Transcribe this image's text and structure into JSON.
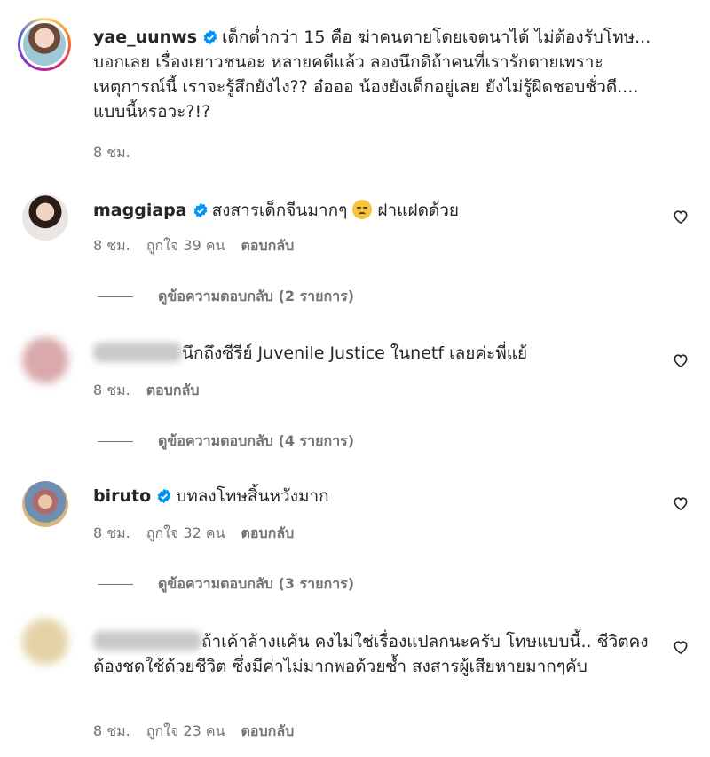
{
  "comments": [
    {
      "username": "yae_uunws",
      "text": "เด็กต่ำกว่า 15 คือ ฆ่าคนตายโดยเจตนาได้ ไม่ต้องรับโทษ... บอกเลย เรื่องเยาวชนอะ หลายคดีแล้ว ลองนึกดิถ้าคนที่เรารักตายเพราะเหตุการณ์นี้ เราจะรู้สึกยังไง?? อ๋อออ น้องยังเด็กอยู่เลย ยังไม่รู้ผิดชอบชั่วดี.... แบบนี้หรอวะ?!?",
      "time": "8 ชม.",
      "verified": true
    },
    {
      "username": "maggiapa",
      "text_before": "สงสารเด็กจีนมากๆ",
      "text_after": "ฝาแฝดด้วย",
      "emoji": "pensive-face",
      "time": "8 ชม.",
      "likes": "ถูกใจ 39 คน",
      "reply": "ตอบกลับ",
      "view_replies": "ดูข้อความตอบกลับ (2 รายการ)",
      "verified": true
    },
    {
      "username": "",
      "text": "นึกถึงซีรีย์ Juvenile Justice ในnetf เลยค่ะพี่แย้",
      "time": "8 ชม.",
      "reply": "ตอบกลับ",
      "view_replies": "ดูข้อความตอบกลับ (4 รายการ)"
    },
    {
      "username": "biruto",
      "text": "บทลงโทษสิ้นหวังมาก",
      "time": "8 ชม.",
      "likes": "ถูกใจ 32 คน",
      "reply": "ตอบกลับ",
      "view_replies": "ดูข้อความตอบกลับ (3 รายการ)",
      "verified": true
    },
    {
      "username": "",
      "text": "ถ้าเค้าล้างแค้น คงไม่ใช่เรื่องแปลกนะครับ โทษแบบนี้.. ชีวิตคงต้องชดใช้ด้วยชีวิต ซึ่งมีค่าไม่มากพอด้วยซ้ำ สงสารผู้เสียหายมากๆคับ",
      "time": "8 ชม.",
      "likes": "ถูกใจ 23 คน",
      "reply": "ตอบกลับ"
    }
  ],
  "icons": {
    "verified": "verified-badge-icon",
    "like": "heart-icon"
  },
  "colors": {
    "verified": "#0095f6",
    "text": "#262626",
    "secondary": "#737373"
  }
}
